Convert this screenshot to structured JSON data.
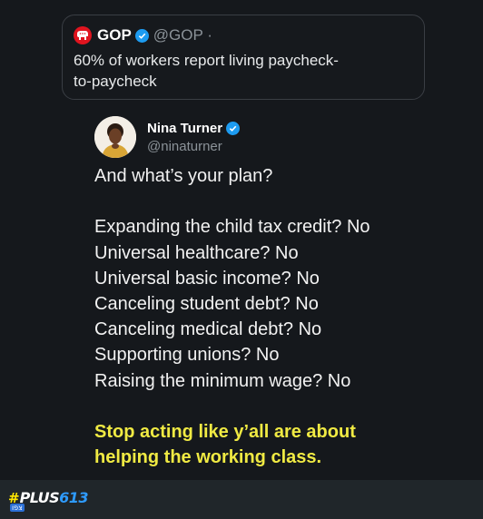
{
  "quoted_tweet": {
    "display_name": "GOP",
    "handle": "@GOP ·",
    "text": "60% of workers report living paycheck-to-paycheck",
    "logo_icon": "gop-elephant-icon",
    "verified_icon": "verified-badge-icon"
  },
  "tweet": {
    "display_name": "Nina Turner",
    "handle": "@ninaturner",
    "lines": [
      "And what’s your plan?",
      "",
      "Expanding the child tax credit? No",
      "Universal healthcare? No",
      "Universal basic income? No",
      "Canceling student debt? No",
      "Canceling medical debt? No",
      "Supporting unions? No",
      "Raising the minimum wage? No",
      ""
    ],
    "highlight_lines": [
      "Stop acting like y’all are about",
      "helping the working class."
    ],
    "highlight_color": "#f0ea43"
  },
  "watermark": {
    "hash": "#",
    "text": "PLUS",
    "number": "613",
    "badge": "צפו"
  },
  "colors": {
    "background": "#15181c",
    "verified": "#1d9bf0",
    "gop_red": "#e0141f",
    "footer": "#20262a"
  }
}
